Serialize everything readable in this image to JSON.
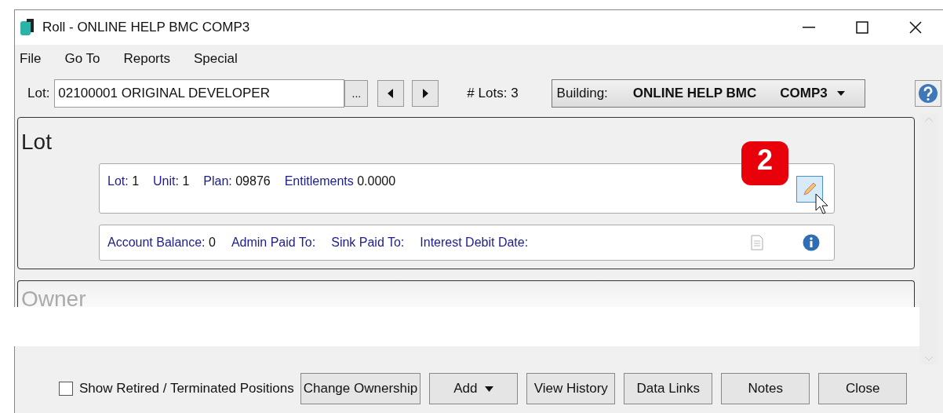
{
  "window": {
    "title": "Roll - ONLINE HELP BMC COMP3"
  },
  "menu": [
    "File",
    "Go To",
    "Reports",
    "Special"
  ],
  "lot_bar": {
    "label": "Lot:",
    "value": "02100001 ORIGINAL DEVELOPER",
    "browse": "...",
    "lots_label": "# Lots:",
    "lots_count": "3",
    "building_label": "Building:",
    "building_name": "ONLINE HELP BMC",
    "building_code": "COMP3"
  },
  "lot_panel": {
    "title": "Lot",
    "badge": "2",
    "details": [
      {
        "label": "Lot:",
        "value": "1"
      },
      {
        "label": "Unit:",
        "value": "1"
      },
      {
        "label": "Plan:",
        "value": "09876"
      },
      {
        "label": "Entitlements",
        "value": "0.0000"
      }
    ],
    "balances": [
      {
        "label": "Account Balance:",
        "value": "0"
      },
      {
        "label": "Admin Paid To:"
      },
      {
        "label": "Sink Paid To:"
      },
      {
        "label": "Interest Debit Date:"
      }
    ]
  },
  "owner_panel": {
    "title": "Owner"
  },
  "footer": {
    "checkbox": {
      "label": "Show Retired / Terminated Positions",
      "checked": false
    },
    "buttons": [
      {
        "label": "Change Ownership",
        "kind": "plain"
      },
      {
        "label": "Add",
        "kind": "dropdown"
      },
      {
        "label": "View History",
        "kind": "plain"
      },
      {
        "label": "Data Links",
        "kind": "plain"
      },
      {
        "label": "Notes",
        "kind": "plain"
      },
      {
        "label": "Close",
        "kind": "plain"
      }
    ]
  }
}
